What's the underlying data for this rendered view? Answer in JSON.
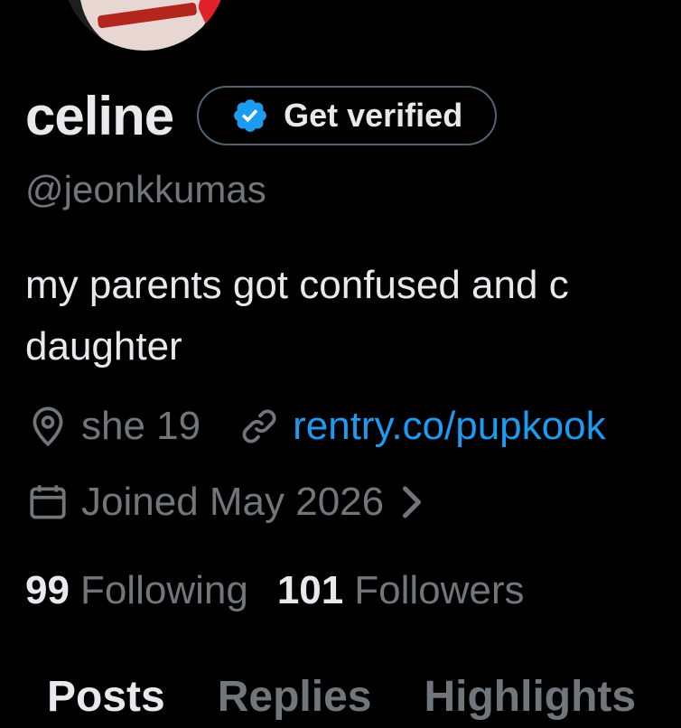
{
  "profile": {
    "display_name": "celine",
    "verify_button_label": "Get verified",
    "handle": "@jeonkkumas",
    "bio_line1": "my parents got confused and c",
    "bio_line2": "daughter",
    "location": "she 19",
    "website": "rentry.co/pupkook",
    "joined": "Joined May 2026",
    "following_count": "99",
    "following_label": "Following",
    "followers_count": "101",
    "followers_label": "Followers"
  },
  "tabs": [
    {
      "label": "Posts",
      "active": true
    },
    {
      "label": "Replies",
      "active": false
    },
    {
      "label": "Highlights",
      "active": false
    }
  ],
  "icons": {
    "verified_badge": "verified-badge-icon",
    "location": "location-pin-icon",
    "link": "link-icon",
    "calendar": "calendar-icon",
    "chevron": "chevron-right-icon"
  },
  "colors": {
    "background": "#000000",
    "primary_text": "#e7e9ea",
    "secondary_text": "#71767b",
    "link": "#1d9bf0",
    "verified_badge": "#1d9bf0"
  }
}
